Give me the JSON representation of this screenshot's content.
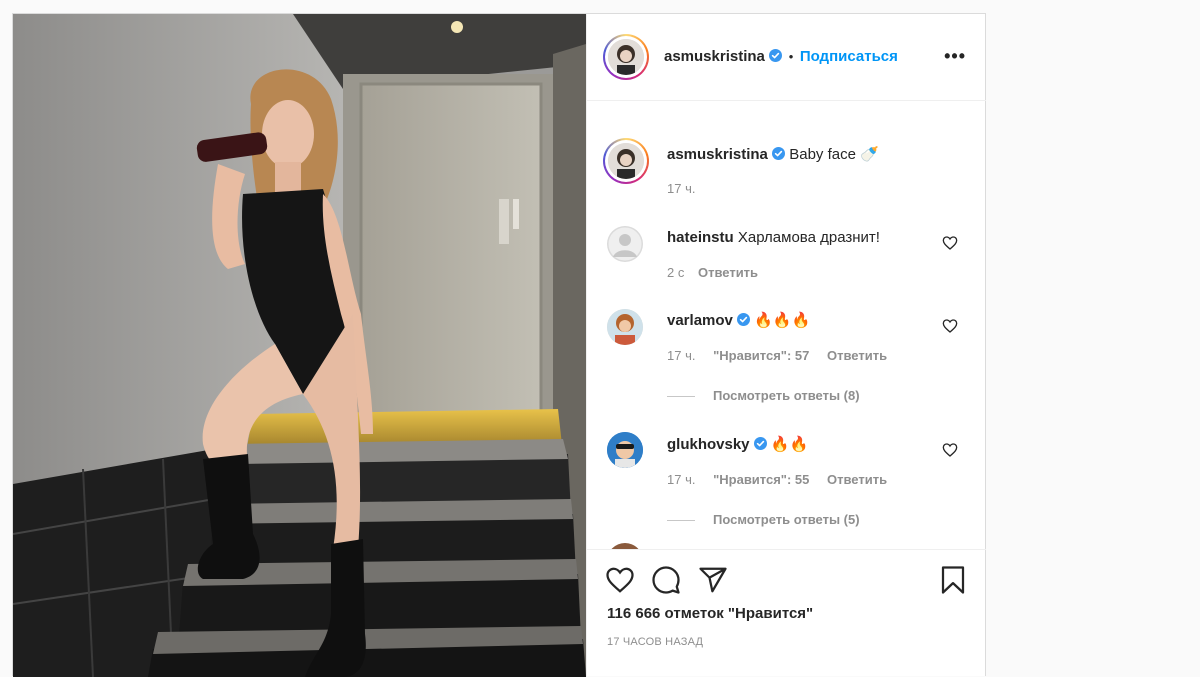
{
  "post": {
    "author": "asmuskristina",
    "follow_label": "Подписаться",
    "separator": "•",
    "more_label": "•••",
    "caption": {
      "author": "asmuskristina",
      "text": "Baby face 🍼",
      "time": "17 ч."
    },
    "comments": [
      {
        "author": "hateinstu",
        "text": "Харламова дразнит!",
        "time": "2 с",
        "reply": "Ответить"
      },
      {
        "author": "varlamov",
        "text": "🔥🔥🔥",
        "time": "17 ч.",
        "likes": "\"Нравится\": 57",
        "reply": "Ответить",
        "view_replies": "Посмотреть ответы (8)"
      },
      {
        "author": "glukhovsky",
        "text": "🔥🔥",
        "time": "17 ч.",
        "likes": "\"Нравится\": 55",
        "reply": "Ответить",
        "view_replies": "Посмотреть ответы (5)"
      }
    ],
    "likes_count": "116 666 отметок \"Нравится\"",
    "timestamp": "17 ЧАСОВ НАЗАД"
  },
  "colors": {
    "link_blue": "#0095f6",
    "verified_blue": "#3897f0",
    "muted": "#8e8e8e"
  },
  "icons": [
    "more-icon",
    "verified-icon",
    "heart-icon",
    "comment-icon",
    "share-icon",
    "bookmark-icon"
  ]
}
